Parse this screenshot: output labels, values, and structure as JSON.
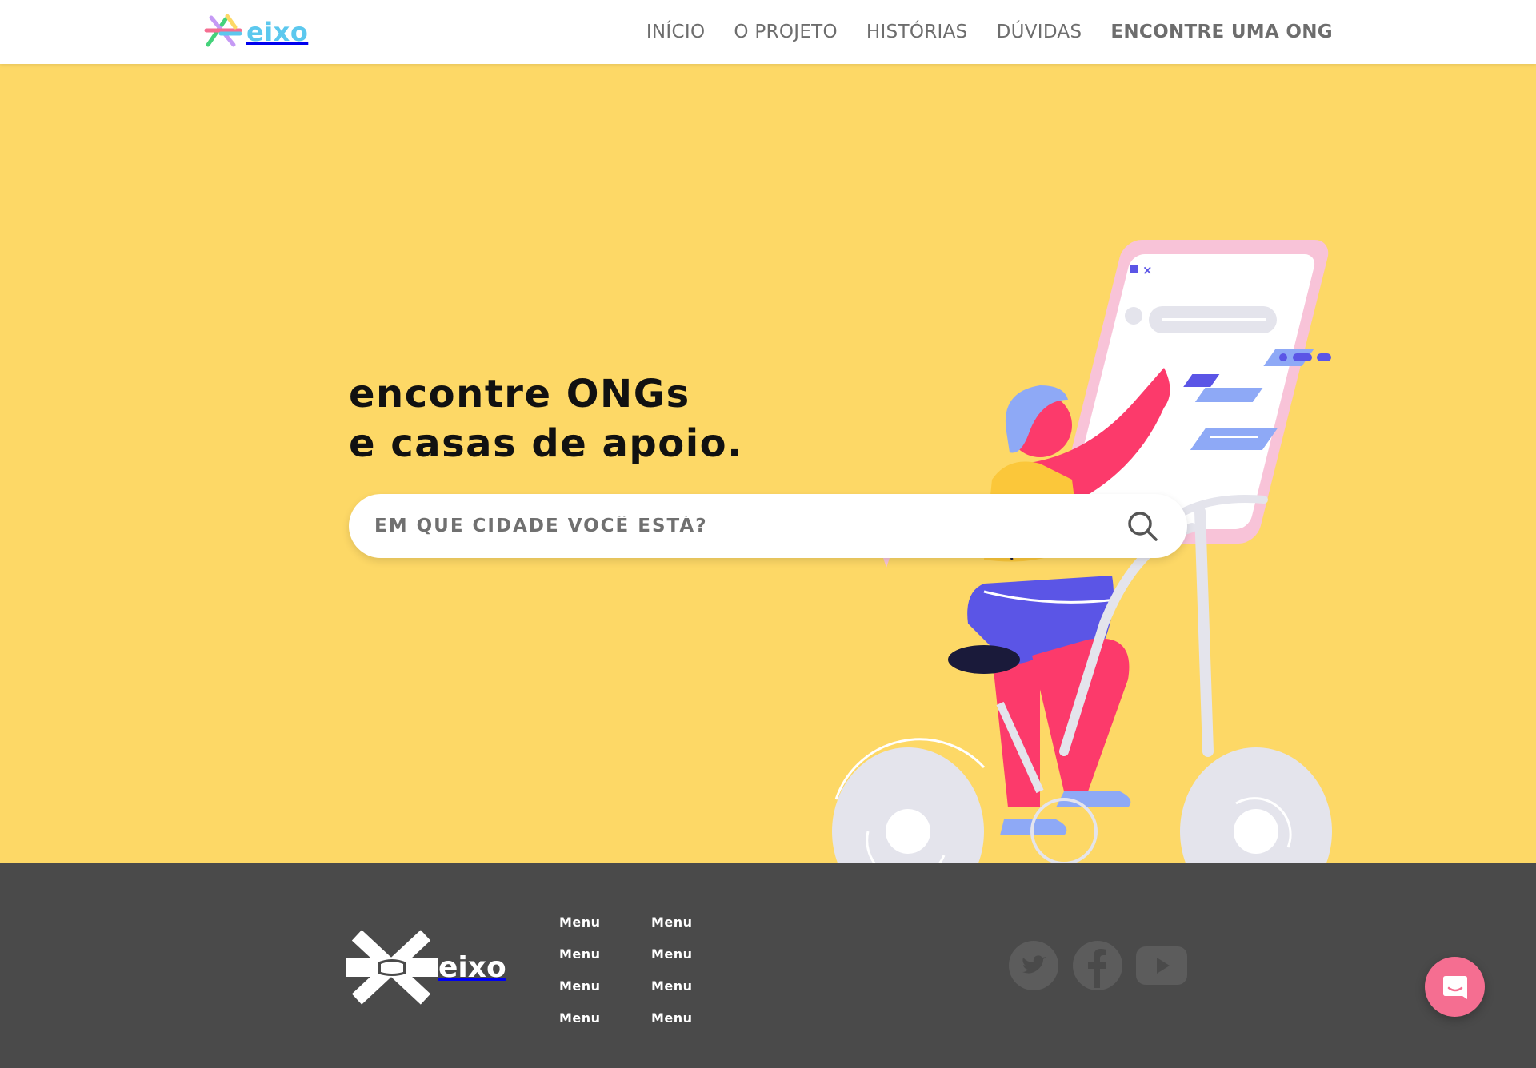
{
  "header": {
    "logo_text": "eixo",
    "nav": [
      {
        "label": "INÍCIO"
      },
      {
        "label": "O PROJETO"
      },
      {
        "label": "HISTÓRIAS"
      },
      {
        "label": "DÚVIDAS"
      },
      {
        "label": "ENCONTRE UMA ONG"
      }
    ]
  },
  "hero": {
    "title_line1": "encontre ONGs",
    "title_line2": "e casas de apoio.",
    "search": {
      "placeholder": "EM QUE CIDADE VOCÊ ESTÁ?",
      "icon": "search-icon"
    }
  },
  "footer": {
    "logo_text": "eixo",
    "menu_col1": [
      "Menu",
      "Menu",
      "Menu",
      "Menu"
    ],
    "menu_col2": [
      "Menu",
      "Menu",
      "Menu",
      "Menu"
    ],
    "socials": [
      "twitter-icon",
      "facebook-icon",
      "youtube-icon"
    ]
  },
  "chat": {
    "icon": "chat-icon"
  },
  "colors": {
    "hero_bg": "#fdd866",
    "footer_bg": "#4a4a4a",
    "logo_blue": "#5cc8ee",
    "chat_pink": "#f56e91",
    "nav_text": "#6d6d6d"
  }
}
